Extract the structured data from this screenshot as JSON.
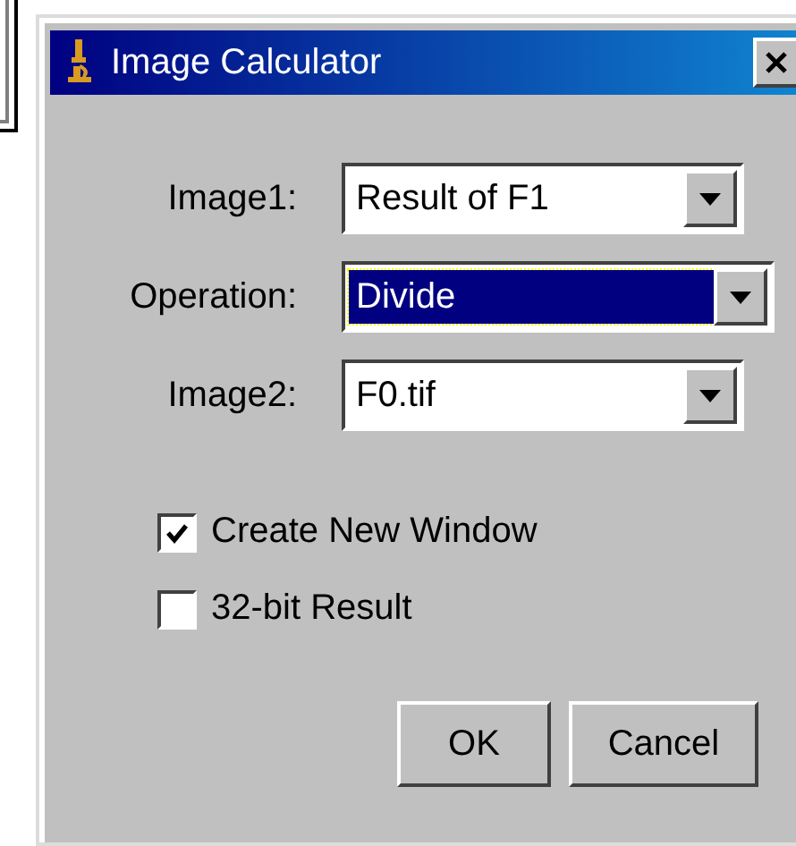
{
  "window": {
    "title": "Image Calculator"
  },
  "fields": [
    {
      "label": "Image1:",
      "value": "Result of F1",
      "focused": false
    },
    {
      "label": "Operation:",
      "value": "Divide",
      "focused": true
    },
    {
      "label": "Image2:",
      "value": "F0.tif",
      "focused": false
    }
  ],
  "checkboxes": [
    {
      "label": "Create New Window",
      "checked": true
    },
    {
      "label": "32-bit Result",
      "checked": false
    }
  ],
  "buttons": [
    "OK",
    "Cancel"
  ]
}
